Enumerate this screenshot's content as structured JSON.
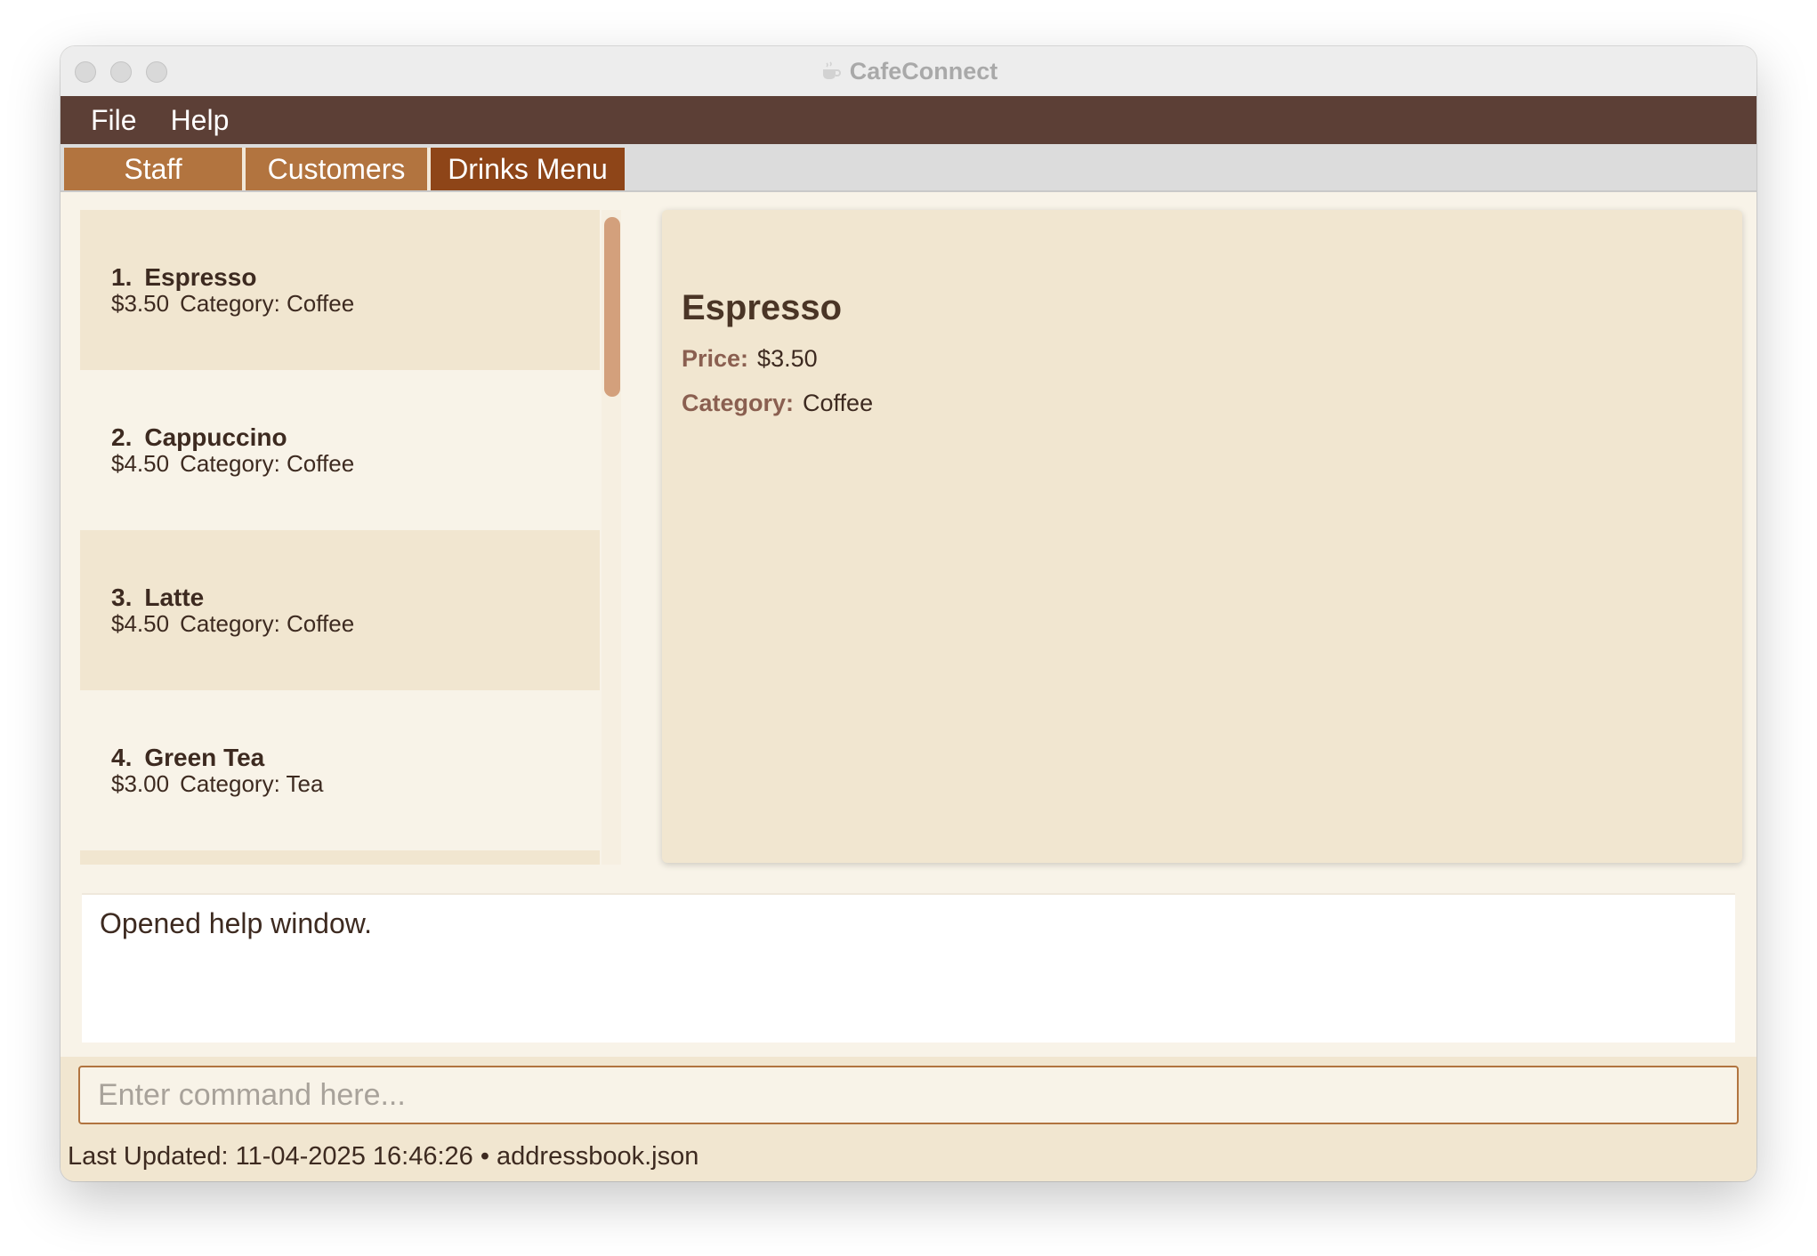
{
  "window": {
    "title": "CafeConnect"
  },
  "menubar": {
    "items": [
      "File",
      "Help"
    ]
  },
  "tabs": [
    {
      "label": "Staff",
      "active": false
    },
    {
      "label": "Customers",
      "active": false
    },
    {
      "label": "Drinks Menu",
      "active": true
    }
  ],
  "drinks": [
    {
      "index": "1.",
      "name": "Espresso",
      "price": "$3.50",
      "category": "Category: Coffee"
    },
    {
      "index": "2.",
      "name": "Cappuccino",
      "price": "$4.50",
      "category": "Category: Coffee"
    },
    {
      "index": "3.",
      "name": "Latte",
      "price": "$4.50",
      "category": "Category: Coffee"
    },
    {
      "index": "4.",
      "name": "Green Tea",
      "price": "$3.00",
      "category": "Category: Tea"
    }
  ],
  "detail": {
    "name": "Espresso",
    "price_label": "Price:",
    "price_value": "$3.50",
    "category_label": "Category:",
    "category_value": "Coffee"
  },
  "result": {
    "text": "Opened help window."
  },
  "command": {
    "placeholder": "Enter command here...",
    "value": ""
  },
  "status": {
    "text": "Last Updated: 11-04-2025 16:46:26 • addressbook.json"
  },
  "colors": {
    "menubar": "#5c3f36",
    "tab": "#b2743f",
    "tab_active": "#8e4518",
    "list_alt": "#f1e6d0",
    "scroll_thumb": "#d3a07c"
  }
}
